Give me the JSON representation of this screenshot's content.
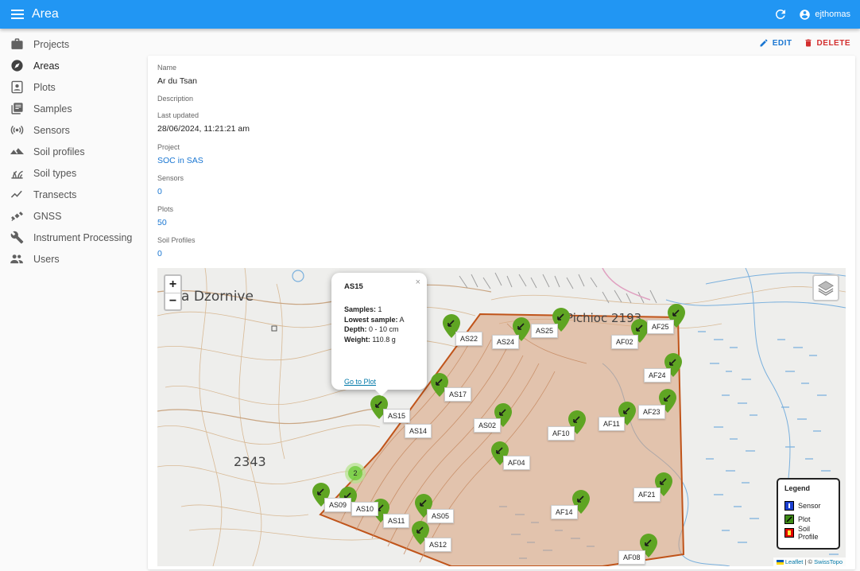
{
  "appbar": {
    "title": "Area",
    "user": "ejthomas",
    "color": "#2196f3"
  },
  "sidebar": {
    "items": [
      {
        "label": "Projects",
        "icon": "briefcase-icon"
      },
      {
        "label": "Areas",
        "icon": "compass-icon",
        "active": true
      },
      {
        "label": "Plots",
        "icon": "plot-icon"
      },
      {
        "label": "Samples",
        "icon": "library-icon"
      },
      {
        "label": "Sensors",
        "icon": "sensor-icon"
      },
      {
        "label": "Soil profiles",
        "icon": "terrain-icon"
      },
      {
        "label": "Soil types",
        "icon": "grass-icon"
      },
      {
        "label": "Transects",
        "icon": "timeline-icon"
      },
      {
        "label": "GNSS",
        "icon": "satellite-icon"
      },
      {
        "label": "Instrument Processing",
        "icon": "wrench-icon"
      },
      {
        "label": "Users",
        "icon": "people-icon"
      }
    ]
  },
  "actions": {
    "edit": "EDIT",
    "delete": "DELETE"
  },
  "fields": {
    "name": {
      "label": "Name",
      "value": "Ar du Tsan"
    },
    "description": {
      "label": "Description",
      "value": ""
    },
    "last_updated": {
      "label": "Last updated",
      "value": "28/06/2024, 11:21:21 am"
    },
    "project": {
      "label": "Project",
      "value": "SOC in SAS"
    },
    "sensors": {
      "label": "Sensors",
      "value": "0"
    },
    "plots": {
      "label": "Plots",
      "value": "50"
    },
    "soil_profiles": {
      "label": "Soil Profiles",
      "value": "0"
    }
  },
  "map": {
    "zoom_in": "+",
    "zoom_out": "−",
    "place_names": [
      "a Dzornive",
      "Pichioc 2193",
      "2343"
    ],
    "popup": {
      "title": "AS15",
      "close": "×",
      "samples_label": "Samples:",
      "samples_value": "1",
      "lowest_label": "Lowest sample:",
      "lowest_value": "A",
      "depth_label": "Depth:",
      "depth_value": "0 - 10 cm",
      "weight_label": "Weight:",
      "weight_value": "110.8 g",
      "link": "Go to Plot"
    },
    "cluster_count": "2",
    "plot_labels": [
      "AS22",
      "AS24",
      "AS25",
      "AF25",
      "AF02",
      "AF24",
      "AS17",
      "AF23",
      "AS15",
      "AS14",
      "AS02",
      "AF10",
      "AF11",
      "AF04",
      "AS09",
      "AS10",
      "AS11",
      "AS05",
      "AS12",
      "AF14",
      "AF21",
      "AF08"
    ],
    "legend": {
      "title": "Legend",
      "sensor": "Sensor",
      "plot": "Plot",
      "soil_profile": "Soil Profile"
    },
    "attribution": {
      "leaflet": "Leaflet",
      "sep": " | © ",
      "swisstopo": "SwissTopo"
    },
    "colors": {
      "area_outline": "#c0541a",
      "area_fill": "#d9a07a",
      "marker": "#5fa523",
      "water": "#7ab0dd"
    }
  }
}
